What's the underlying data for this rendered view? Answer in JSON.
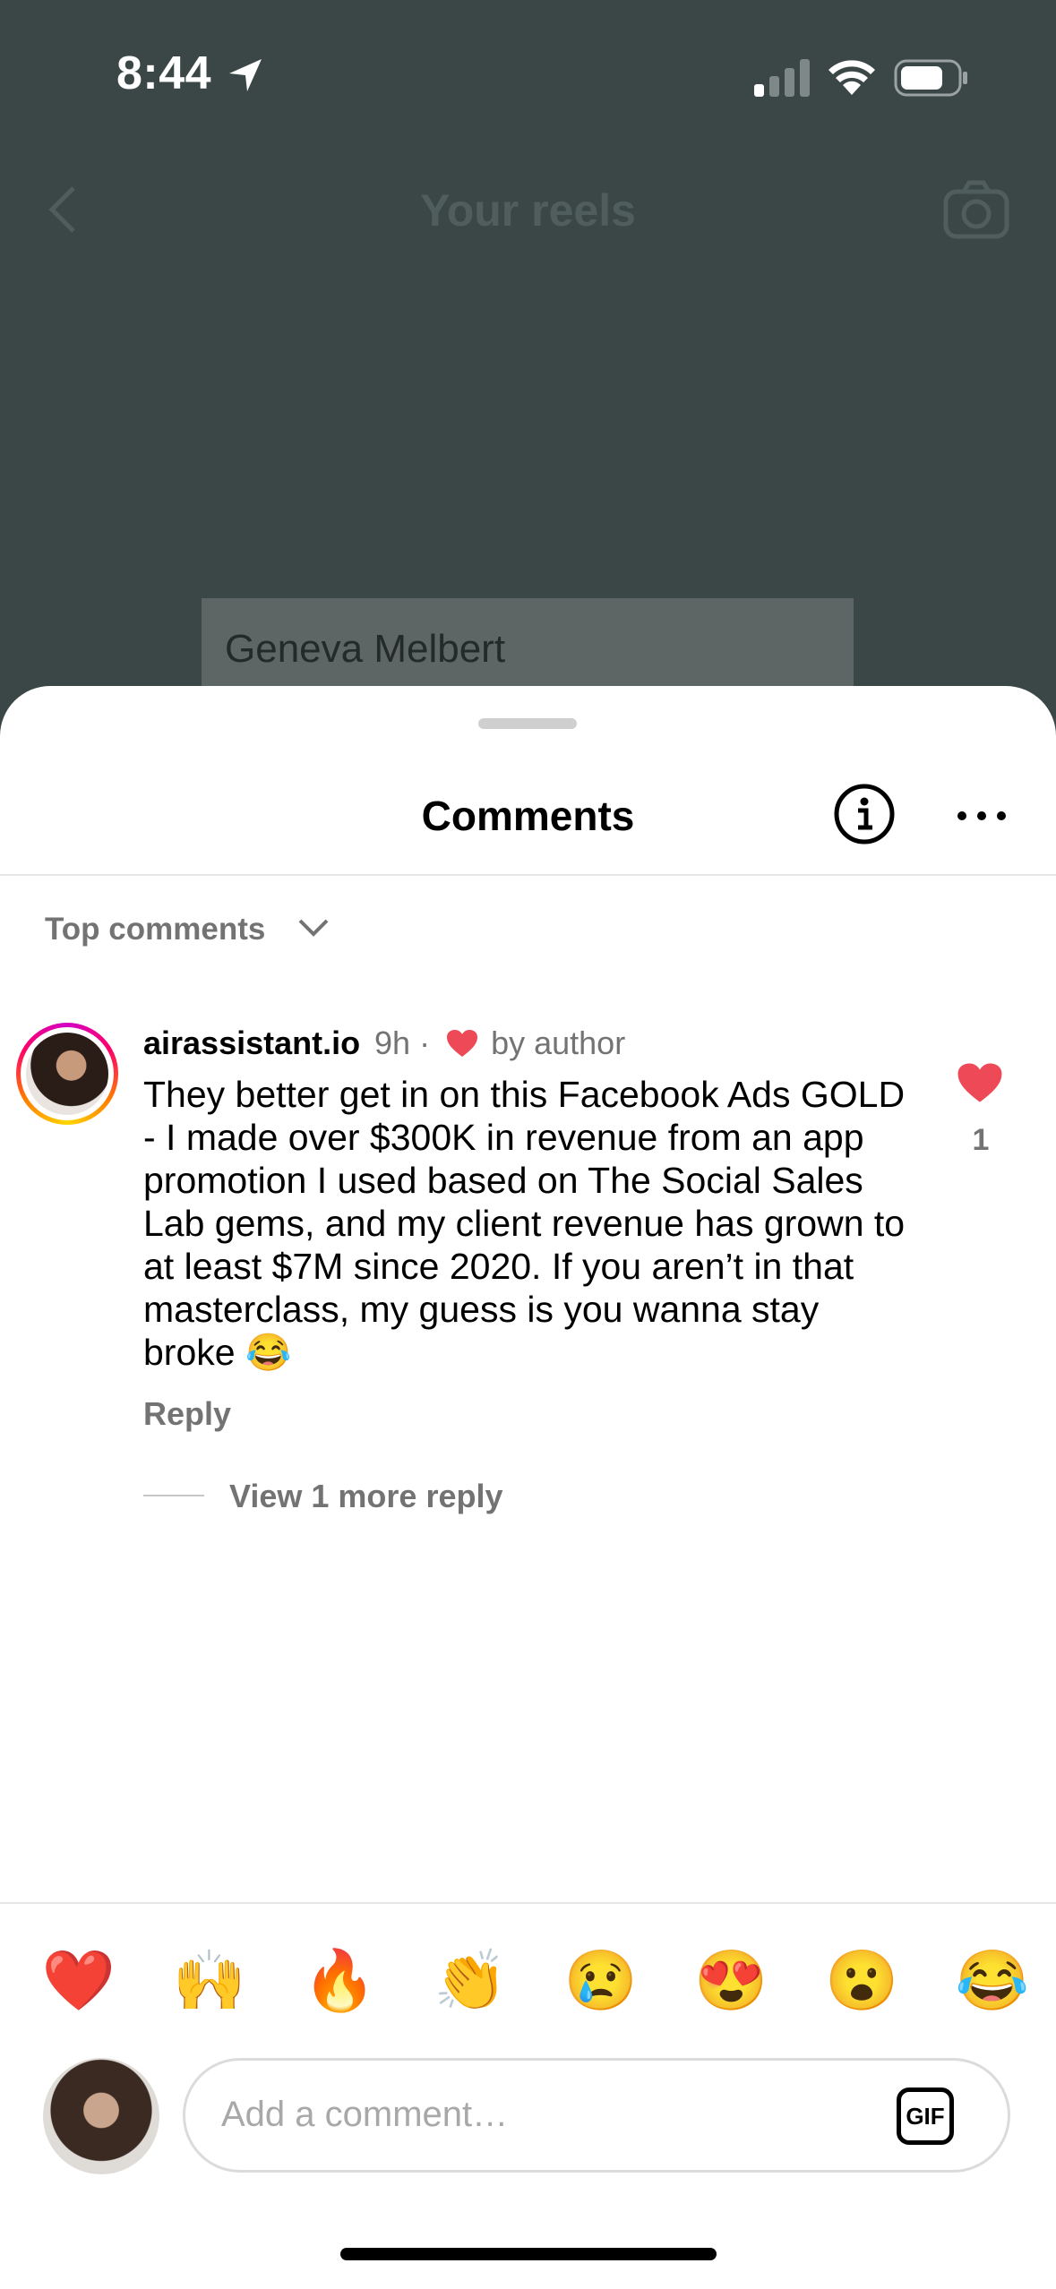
{
  "status_bar": {
    "time": "8:44"
  },
  "background": {
    "title": "Your reels",
    "card_name": "Geneva Melbert"
  },
  "sheet": {
    "title": "Comments",
    "sort_label": "Top comments"
  },
  "comment": {
    "username": "airassistant.io",
    "time": "9h",
    "separator": "·",
    "liked_by_label": "by author",
    "text": "They better get in on this Facebook Ads GOLD - I made over $300K in revenue from an app promotion I used based on The Social Sales Lab gems, and my client revenue has grown to at least $7M since 2020. If you aren’t in that masterclass, my guess is you wanna stay broke 😂",
    "reply_label": "Reply",
    "like_count": "1",
    "view_more_label": "View 1 more reply"
  },
  "emoji_bar": [
    "❤️",
    "🙌",
    "🔥",
    "👏",
    "😢",
    "😍",
    "😮",
    "😂"
  ],
  "composer": {
    "placeholder": "Add a comment…",
    "gif_label": "GIF"
  },
  "colors": {
    "like_red": "#ed4956",
    "secondary_text": "#737373",
    "dim_background": "#3b4746"
  }
}
